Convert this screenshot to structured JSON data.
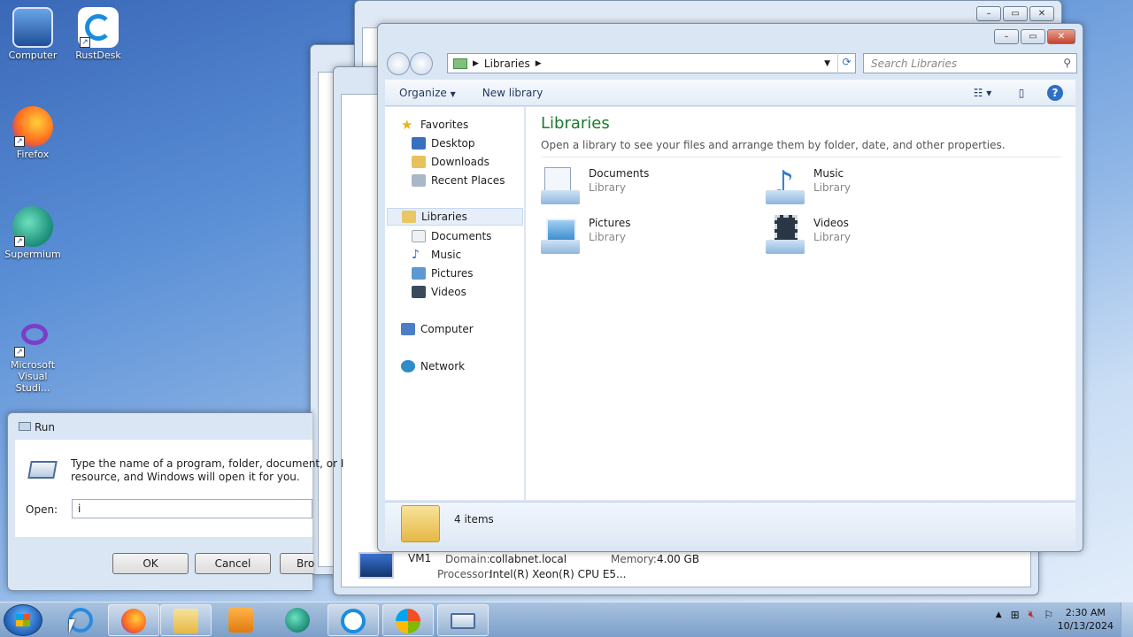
{
  "desktop": {
    "icons": [
      {
        "label": "Computer"
      },
      {
        "label": "RustDesk"
      },
      {
        "label": "Firefox"
      },
      {
        "label": "Supermium"
      },
      {
        "label": "Microsoft Visual Studi..."
      }
    ]
  },
  "explorer": {
    "breadcrumb": "Libraries",
    "search_placeholder": "Search Libraries",
    "toolbar": {
      "organize": "Organize",
      "new_library": "New library"
    },
    "nav": {
      "favorites": "Favorites",
      "desktop": "Desktop",
      "downloads": "Downloads",
      "recent": "Recent Places",
      "libraries": "Libraries",
      "documents": "Documents",
      "music": "Music",
      "pictures": "Pictures",
      "videos": "Videos",
      "computer": "Computer",
      "network": "Network"
    },
    "heading": "Libraries",
    "subheading": "Open a library to see your files and arrange them by folder, date, and other properties.",
    "libraries": [
      {
        "name": "Documents",
        "type": "Library"
      },
      {
        "name": "Music",
        "type": "Library"
      },
      {
        "name": "Pictures",
        "type": "Library"
      },
      {
        "name": "Videos",
        "type": "Library"
      }
    ],
    "item_count": "4 items"
  },
  "system_window": {
    "name": "VM1",
    "domain_label": "Domain:",
    "domain": "collabnet.local",
    "memory_label": "Memory:",
    "memory": "4.00 GB",
    "processor_label": "Processor:",
    "processor": "Intel(R) Xeon(R) CPU E5..."
  },
  "run": {
    "title": "Run",
    "desc_line1": "Type the name of a program, folder, document, or I",
    "desc_line2": "resource, and Windows will open it for you.",
    "open_label": "Open:",
    "open_value": "i",
    "ok": "OK",
    "cancel": "Cancel",
    "browse": "Bro"
  },
  "taskbar": {
    "time": "2:30 AM",
    "date": "10/13/2024"
  }
}
